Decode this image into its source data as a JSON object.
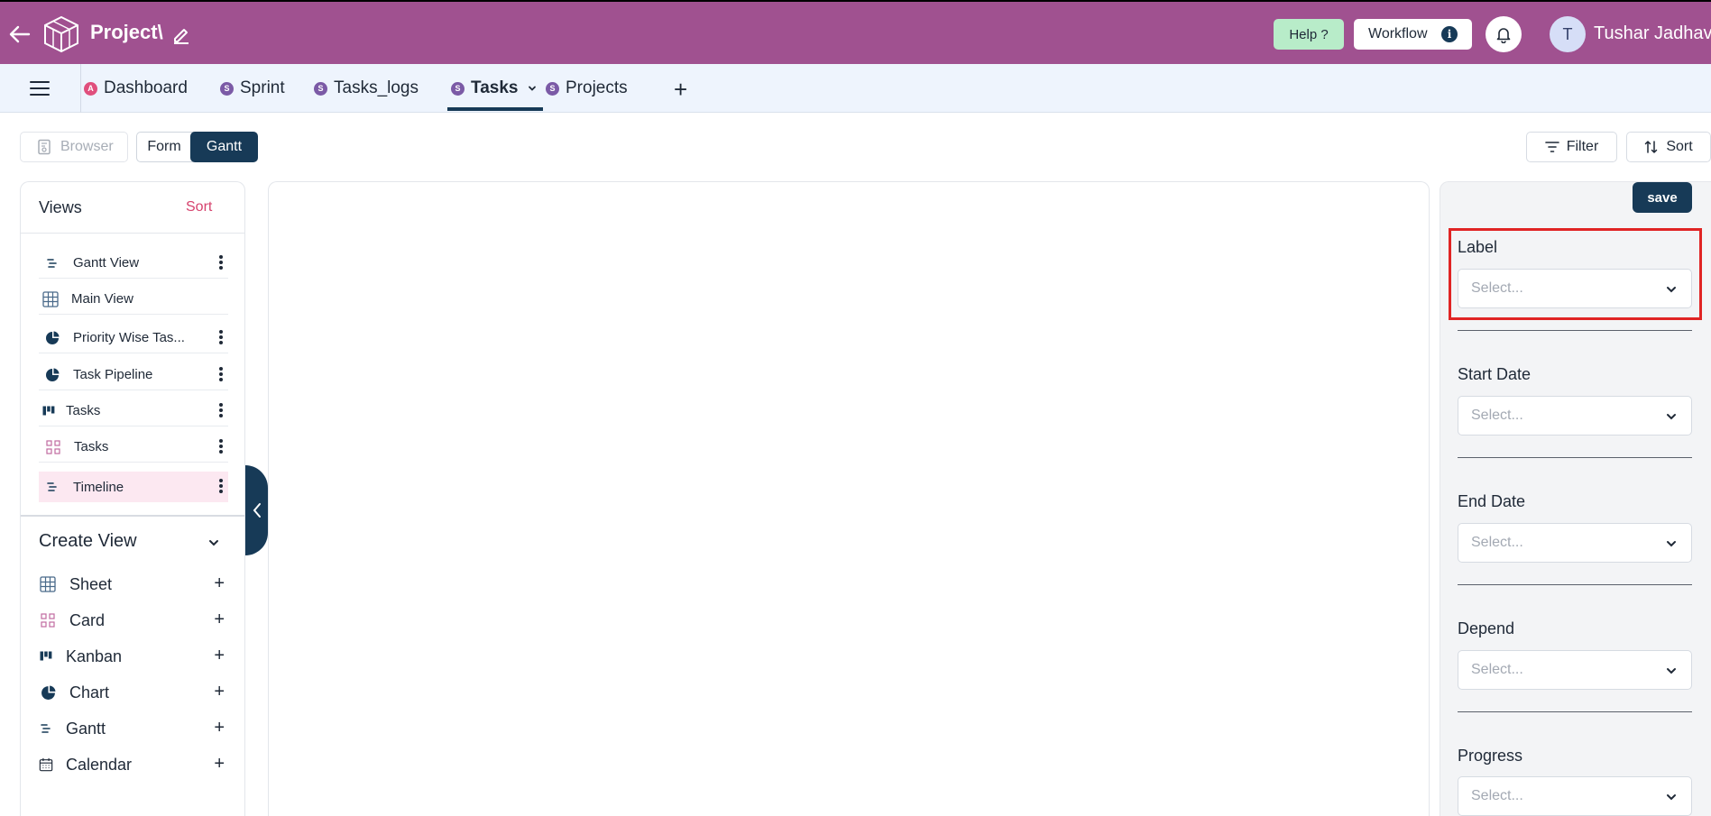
{
  "header": {
    "project_title": "Project\\",
    "help_label": "Help ?",
    "workflow_label": "Workflow",
    "workflow_info": "i",
    "avatar_initial": "T",
    "user_name": "Tushar Jadhav",
    "bg_color": "#a05190"
  },
  "tabs": [
    {
      "badge": "A",
      "label": "Dashboard",
      "badge_color": "#e04f7d"
    },
    {
      "badge": "S",
      "label": "Sprint",
      "badge_color": "#7b5aa6"
    },
    {
      "badge": "S",
      "label": "Tasks_logs",
      "badge_color": "#7b5aa6"
    },
    {
      "badge": "S",
      "label": "Tasks",
      "badge_color": "#7b5aa6",
      "active": true
    },
    {
      "badge": "S",
      "label": "Projects",
      "badge_color": "#7b5aa6"
    }
  ],
  "tab_add": "+",
  "toolbar": {
    "browser_label": "Browser",
    "form_label": "Form",
    "gantt_label": "Gantt",
    "filter_label": "Filter",
    "sort_label": "Sort"
  },
  "views": {
    "title": "Views",
    "sort_label": "Sort",
    "items": [
      {
        "label": "Gantt View",
        "icon": "gantt-icon"
      },
      {
        "label": "Main View",
        "icon": "sheet-icon"
      },
      {
        "label": "Priority Wise Tas...",
        "icon": "chart-icon"
      },
      {
        "label": "Task Pipeline",
        "icon": "chart-icon"
      },
      {
        "label": "Tasks",
        "icon": "kanban-icon"
      },
      {
        "label": "Tasks",
        "icon": "card-icon"
      },
      {
        "label": "Timeline",
        "icon": "gantt-icon",
        "selected": true
      }
    ]
  },
  "create_view": {
    "title": "Create View",
    "items": [
      {
        "label": "Sheet",
        "icon": "sheet-icon"
      },
      {
        "label": "Card",
        "icon": "card-icon"
      },
      {
        "label": "Kanban",
        "icon": "kanban-icon"
      },
      {
        "label": "Chart",
        "icon": "chart-icon"
      },
      {
        "label": "Gantt",
        "icon": "gantt-icon"
      },
      {
        "label": "Calendar",
        "icon": "calendar-icon"
      }
    ],
    "add_symbol": "+"
  },
  "settings": {
    "save_label": "save",
    "fields": [
      {
        "label": "Label",
        "placeholder": "Select..."
      },
      {
        "label": "Start Date",
        "placeholder": "Select..."
      },
      {
        "label": "End Date",
        "placeholder": "Select..."
      },
      {
        "label": "Depend",
        "placeholder": "Select..."
      },
      {
        "label": "Progress",
        "placeholder": "Select..."
      }
    ]
  },
  "colors": {
    "primary_dark": "#173a57",
    "accent_pink": "#d6436e",
    "highlight_red": "#e02424"
  }
}
